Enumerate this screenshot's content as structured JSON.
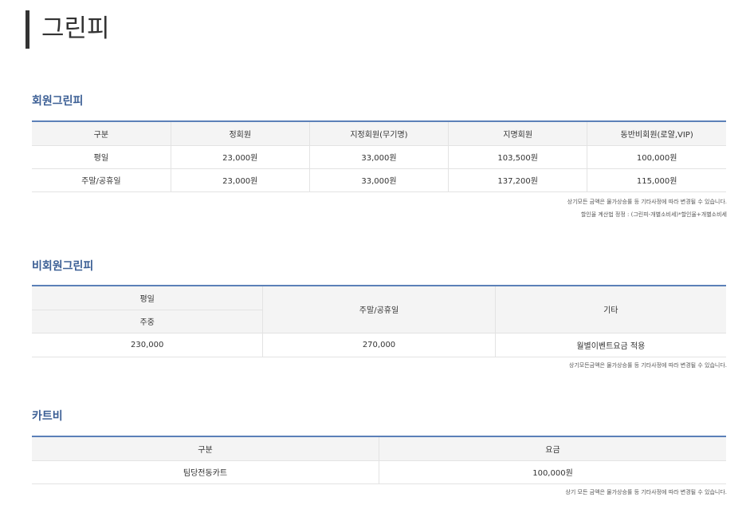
{
  "page": {
    "title": "그린피"
  },
  "member": {
    "title": "회원그린피",
    "headers": [
      "구분",
      "정회원",
      "지정회원(무기명)",
      "지명회원",
      "동반비회원(로얄,VIP)"
    ],
    "rows": [
      [
        "평일",
        "23,000원",
        "33,000원",
        "103,500원",
        "100,000원"
      ],
      [
        "주말/공휴일",
        "23,000원",
        "33,000원",
        "137,200원",
        "115,000원"
      ]
    ],
    "notes": [
      "상기모든 금액은 물가상승률 등 기타사정에 따라 변경될 수 있습니다.",
      "할인율 계산법 정정 : (그린피-개별소비세)*할인율+개별소비세"
    ]
  },
  "nonmember": {
    "title": "비회원그린피",
    "headers": {
      "weekday": "평일",
      "weekday_sub": "주중",
      "weekend": "주말/공휴일",
      "etc": "기타"
    },
    "row": [
      "230,000",
      "270,000",
      "월별이벤트요금 적용"
    ],
    "note": "상기모든금액은 물가상승률 등 기타사정에 따라 변경될 수 있습니다."
  },
  "cart": {
    "title": "카트비",
    "headers": [
      "구분",
      "요금"
    ],
    "row": [
      "팀당전동카트",
      "100,000원"
    ],
    "note": "상기 모든 금액은 물가상승률 등 기타사정에 따라 변경될 수 있습니다."
  }
}
